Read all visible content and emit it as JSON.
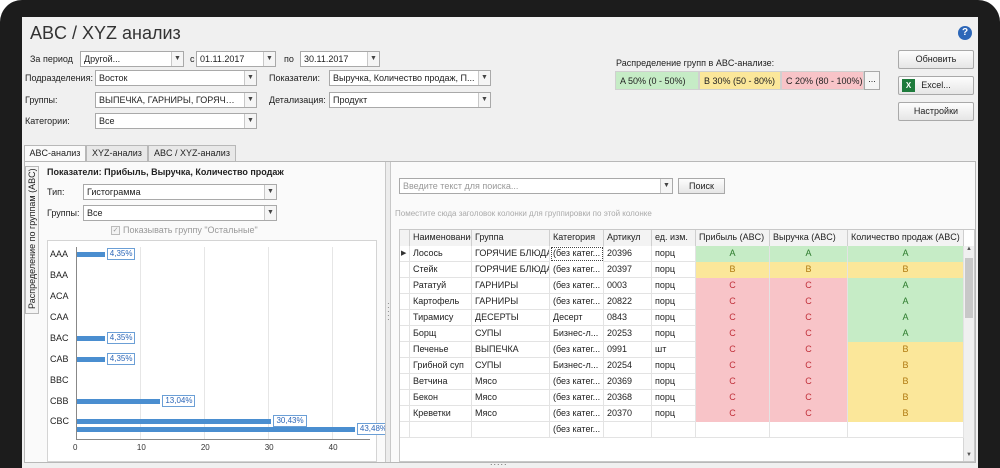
{
  "title": "ABC / XYZ анализ",
  "filters": {
    "period_label": "За период",
    "period_value": "Другой...",
    "from_label": "с",
    "from_value": "01.11.2017",
    "to_label": "по",
    "to_value": "30.11.2017",
    "division_label": "Подразделения:",
    "division_value": "Восток",
    "groups_label": "Группы:",
    "groups_value": "ВЫПЕЧКА, ГАРНИРЫ, ГОРЯЧИЕ БЛ...",
    "categories_label": "Категории:",
    "categories_value": "Все",
    "indicators_label": "Показатели:",
    "indicators_value": "Выручка, Количество продаж, П...",
    "detail_label": "Детализация:",
    "detail_value": "Продукт"
  },
  "distribution": {
    "title": "Распределение групп в ABC-анализе:",
    "a": "A 50% (0 - 50%)",
    "b": "B 30% (50 - 80%)",
    "c": "C 20% (80 - 100%)",
    "more": "..."
  },
  "buttons": {
    "refresh": "Обновить",
    "excel": "Excel...",
    "settings": "Настройки"
  },
  "tabs": [
    "ABC-анализ",
    "XYZ-анализ",
    "ABC / XYZ-анализ"
  ],
  "side_tab": "Распределение по группам (ABC)",
  "left": {
    "title": "Показатели: Прибыль, Выручка, Количество продаж",
    "type_label": "Тип:",
    "type_value": "Гистограмма",
    "groups_label": "Группы:",
    "groups_value": "Все",
    "show_other": "Показывать группу \"Остальные\""
  },
  "chart_data": {
    "type": "bar",
    "orientation": "horizontal",
    "categories": [
      "AAA",
      "BAA",
      "ACA",
      "CAA",
      "BAC",
      "CAB",
      "BBC",
      "CBB",
      "CBC"
    ],
    "series": [
      {
        "values": [
          4.35,
          0,
          0,
          0,
          4.35,
          4.35,
          0,
          13.04,
          30.43
        ]
      },
      {
        "values": [
          0,
          0,
          0,
          0,
          0,
          0,
          0,
          0,
          43.48
        ]
      }
    ],
    "data_labels": [
      "4,35%",
      "4,35%",
      "4,35%",
      "13,04%",
      "30,43%",
      "43,48%"
    ],
    "xlim": [
      0,
      46
    ],
    "ticks": [
      0,
      10,
      20,
      30,
      40
    ]
  },
  "search": {
    "placeholder": "Введите текст для поиска...",
    "button": "Поиск",
    "group_hint": "Поместите сюда заголовок колонки для группировки по этой колонке"
  },
  "table": {
    "columns": [
      "Наименование",
      "Группа",
      "Категория",
      "Артикул",
      "ед. изм.",
      "Прибыль (ABC)",
      "Выручка (ABC)",
      "Количество продаж (ABC)"
    ],
    "rows": [
      [
        "Лосось",
        "ГОРЯЧИЕ БЛЮДА",
        "(без катег...",
        "20396",
        "порц",
        "A",
        "A",
        "A"
      ],
      [
        "Стейк",
        "ГОРЯЧИЕ БЛЮДА",
        "(без катег...",
        "20397",
        "порц",
        "B",
        "B",
        "B"
      ],
      [
        "Рататуй",
        "ГАРНИРЫ",
        "(без катег...",
        "0003",
        "порц",
        "C",
        "C",
        "A"
      ],
      [
        "Картофель",
        "ГАРНИРЫ",
        "(без катег...",
        "20822",
        "порц",
        "C",
        "C",
        "A"
      ],
      [
        "Тирамису",
        "ДЕСЕРТЫ",
        "Десерт",
        "0843",
        "порц",
        "C",
        "C",
        "A"
      ],
      [
        "Борщ",
        "СУПЫ",
        "Бизнес-л...",
        "20253",
        "порц",
        "C",
        "C",
        "A"
      ],
      [
        "Печенье",
        "ВЫПЕЧКА",
        "(без катег...",
        "0991",
        "шт",
        "C",
        "C",
        "B"
      ],
      [
        "Грибной суп",
        "СУПЫ",
        "Бизнес-л...",
        "20254",
        "порц",
        "C",
        "C",
        "B"
      ],
      [
        "Ветчина",
        "Мясо",
        "(без катег...",
        "20369",
        "порц",
        "C",
        "C",
        "B"
      ],
      [
        "Бекон",
        "Мясо",
        "(без катег...",
        "20368",
        "порц",
        "C",
        "C",
        "B"
      ],
      [
        "Креветки",
        "Мясо",
        "(без катег...",
        "20370",
        "порц",
        "C",
        "C",
        "B"
      ],
      [
        "",
        "",
        "(без катег...",
        "",
        "",
        "",
        "",
        ""
      ]
    ]
  },
  "colors": {
    "group_a": "#c6ecc6",
    "group_b": "#fbe79a",
    "group_c": "#f8c4c8",
    "bar": "#4a8ed0"
  }
}
